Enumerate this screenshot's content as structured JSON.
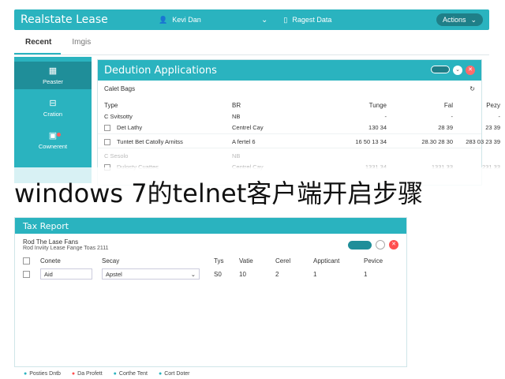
{
  "app": {
    "title": "Realstate Lease",
    "user": "Kevi Dan",
    "register": "Ragest Data",
    "action": "Actions"
  },
  "tabs": [
    {
      "label": "Recent"
    },
    {
      "label": "Imgis"
    }
  ],
  "sidebar": {
    "items": [
      {
        "label": "Peaster",
        "icon": "building-icon"
      },
      {
        "label": "Cration",
        "icon": "folder-icon"
      },
      {
        "label": "Cownerent",
        "icon": "chart-icon"
      }
    ]
  },
  "main": {
    "title": "Dedution Applications",
    "subtitle": "Calet Bags",
    "columns": [
      "Type",
      "BR",
      "Tunge",
      "Fal",
      "Pezy"
    ],
    "group1": {
      "label": "C Svitsotty",
      "br": "NB",
      "t": "-",
      "f": "-",
      "p": "-"
    },
    "rows": [
      {
        "name": "Det Lathy",
        "br": "Centrel Cay",
        "t": "130 34",
        "f": "28 39",
        "p": "23 39"
      },
      {
        "name": "Tuntet Bet Catolly Arnitss",
        "br": "A fertel 6",
        "t": "16 50 13 34",
        "f": "28.30 28 30",
        "p": "283 03 23 39"
      }
    ],
    "group2": {
      "label": "C Sesolo",
      "br": "NB"
    },
    "ghost_row": {
      "name": "Dulosty Cuattes",
      "br": "Centrel Cay",
      "t": "1331 34",
      "f": "1331 33",
      "p": "231 33"
    }
  },
  "overlay_text": "windows 7的telnet客户端开启步骤",
  "tax": {
    "title": "Tax Report",
    "subtitle": "Rod The Lase Fans",
    "subtitle2": "Rod Inviity Lease Fange Toas 2111",
    "columns": [
      "Conete",
      "Secay",
      "Tys",
      "Vatie",
      "Cerel",
      "Appticant",
      "Pevice"
    ],
    "row": {
      "field1": "Aid",
      "field2": "Apstel",
      "c3": "S0",
      "c4": "10",
      "c5": "2",
      "c6": "1",
      "c7": "1"
    }
  },
  "footer": [
    {
      "label": "Posties Dntb",
      "icon": "check-icon"
    },
    {
      "label": "Da Profett",
      "icon": "alert-icon"
    },
    {
      "label": "Corthe Tent",
      "icon": "cart-icon"
    },
    {
      "label": "Cort Doter",
      "icon": "doc-icon"
    }
  ]
}
